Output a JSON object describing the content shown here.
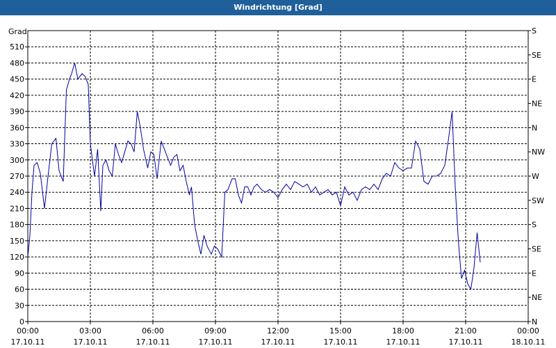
{
  "window": {
    "title": "Windrichtung [Grad]"
  },
  "chart_data": {
    "type": "line",
    "title": "Windrichtung [Grad]",
    "ylabel": "Grad",
    "ylim": [
      0,
      540
    ],
    "yticks": [
      0,
      30,
      60,
      90,
      120,
      150,
      180,
      210,
      240,
      270,
      300,
      330,
      360,
      390,
      420,
      450,
      480,
      510
    ],
    "right_axis_labels": [
      {
        "value": 0,
        "label": "N"
      },
      {
        "value": 45,
        "label": "NE"
      },
      {
        "value": 90,
        "label": "E"
      },
      {
        "value": 135,
        "label": "SE"
      },
      {
        "value": 180,
        "label": "S"
      },
      {
        "value": 225,
        "label": "SW"
      },
      {
        "value": 270,
        "label": "W"
      },
      {
        "value": 315,
        "label": "NW"
      },
      {
        "value": 360,
        "label": "N"
      },
      {
        "value": 405,
        "label": "NE"
      },
      {
        "value": 450,
        "label": "E"
      },
      {
        "value": 495,
        "label": "SE"
      },
      {
        "value": 540,
        "label": "S"
      }
    ],
    "xlim_hours": [
      0,
      24
    ],
    "xticks": [
      {
        "hour": 0,
        "time": "00:00",
        "date": "17.10.11"
      },
      {
        "hour": 3,
        "time": "03:00",
        "date": "17.10.11"
      },
      {
        "hour": 6,
        "time": "06:00",
        "date": "17.10.11"
      },
      {
        "hour": 9,
        "time": "09:00",
        "date": "17.10.11"
      },
      {
        "hour": 12,
        "time": "12:00",
        "date": "17.10.11"
      },
      {
        "hour": 15,
        "time": "15:00",
        "date": "17.10.11"
      },
      {
        "hour": 18,
        "time": "18:00",
        "date": "17.10.11"
      },
      {
        "hour": 21,
        "time": "21:00",
        "date": "17.10.11"
      },
      {
        "hour": 24,
        "time": "00:00",
        "date": "18.10.11"
      }
    ],
    "grid": true,
    "series": [
      {
        "color": "#0000a0",
        "points": [
          [
            0.0,
            120
          ],
          [
            0.1,
            160
          ],
          [
            0.2,
            240
          ],
          [
            0.3,
            290
          ],
          [
            0.45,
            295
          ],
          [
            0.6,
            275
          ],
          [
            0.8,
            210
          ],
          [
            1.0,
            280
          ],
          [
            1.15,
            330
          ],
          [
            1.35,
            340
          ],
          [
            1.5,
            280
          ],
          [
            1.7,
            260
          ],
          [
            1.85,
            430
          ],
          [
            2.0,
            450
          ],
          [
            2.1,
            460
          ],
          [
            2.25,
            480
          ],
          [
            2.4,
            450
          ],
          [
            2.6,
            460
          ],
          [
            2.75,
            455
          ],
          [
            2.9,
            440
          ],
          [
            3.0,
            330
          ],
          [
            3.1,
            300
          ],
          [
            3.2,
            270
          ],
          [
            3.35,
            320
          ],
          [
            3.5,
            205
          ],
          [
            3.6,
            290
          ],
          [
            3.75,
            300
          ],
          [
            3.9,
            280
          ],
          [
            4.05,
            270
          ],
          [
            4.2,
            330
          ],
          [
            4.35,
            310
          ],
          [
            4.5,
            295
          ],
          [
            4.65,
            315
          ],
          [
            4.8,
            335
          ],
          [
            4.95,
            330
          ],
          [
            5.1,
            315
          ],
          [
            5.25,
            390
          ],
          [
            5.4,
            360
          ],
          [
            5.55,
            320
          ],
          [
            5.75,
            285
          ],
          [
            5.9,
            315
          ],
          [
            6.05,
            310
          ],
          [
            6.2,
            265
          ],
          [
            6.4,
            335
          ],
          [
            6.55,
            320
          ],
          [
            6.7,
            305
          ],
          [
            6.85,
            290
          ],
          [
            7.0,
            305
          ],
          [
            7.15,
            310
          ],
          [
            7.3,
            280
          ],
          [
            7.45,
            290
          ],
          [
            7.6,
            260
          ],
          [
            7.75,
            235
          ],
          [
            7.85,
            250
          ],
          [
            8.0,
            180
          ],
          [
            8.15,
            150
          ],
          [
            8.3,
            125
          ],
          [
            8.45,
            160
          ],
          [
            8.6,
            140
          ],
          [
            8.8,
            125
          ],
          [
            8.95,
            140
          ],
          [
            9.1,
            135
          ],
          [
            9.3,
            120
          ],
          [
            9.45,
            240
          ],
          [
            9.6,
            245
          ],
          [
            9.8,
            265
          ],
          [
            9.95,
            265
          ],
          [
            10.1,
            235
          ],
          [
            10.25,
            220
          ],
          [
            10.4,
            250
          ],
          [
            10.55,
            250
          ],
          [
            10.7,
            235
          ],
          [
            10.85,
            250
          ],
          [
            11.0,
            255
          ],
          [
            11.2,
            245
          ],
          [
            11.4,
            240
          ],
          [
            11.6,
            245
          ],
          [
            11.8,
            240
          ],
          [
            12.0,
            230
          ],
          [
            12.2,
            245
          ],
          [
            12.4,
            255
          ],
          [
            12.6,
            245
          ],
          [
            12.8,
            260
          ],
          [
            13.0,
            255
          ],
          [
            13.2,
            250
          ],
          [
            13.4,
            255
          ],
          [
            13.6,
            240
          ],
          [
            13.8,
            250
          ],
          [
            14.0,
            235
          ],
          [
            14.2,
            240
          ],
          [
            14.4,
            245
          ],
          [
            14.6,
            235
          ],
          [
            14.8,
            240
          ],
          [
            15.0,
            215
          ],
          [
            15.2,
            250
          ],
          [
            15.4,
            235
          ],
          [
            15.6,
            240
          ],
          [
            15.8,
            225
          ],
          [
            16.0,
            245
          ],
          [
            16.2,
            250
          ],
          [
            16.4,
            245
          ],
          [
            16.6,
            255
          ],
          [
            16.8,
            245
          ],
          [
            17.0,
            265
          ],
          [
            17.2,
            275
          ],
          [
            17.4,
            270
          ],
          [
            17.6,
            295
          ],
          [
            17.8,
            285
          ],
          [
            18.0,
            280
          ],
          [
            18.2,
            285
          ],
          [
            18.4,
            285
          ],
          [
            18.6,
            335
          ],
          [
            18.8,
            320
          ],
          [
            19.0,
            260
          ],
          [
            19.2,
            255
          ],
          [
            19.4,
            270
          ],
          [
            19.6,
            270
          ],
          [
            19.8,
            275
          ],
          [
            20.0,
            290
          ],
          [
            20.2,
            345
          ],
          [
            20.35,
            390
          ],
          [
            20.5,
            250
          ],
          [
            20.65,
            150
          ],
          [
            20.8,
            80
          ],
          [
            20.95,
            95
          ],
          [
            21.1,
            70
          ],
          [
            21.25,
            60
          ],
          [
            21.4,
            100
          ],
          [
            21.55,
            165
          ],
          [
            21.7,
            110
          ]
        ]
      }
    ]
  }
}
